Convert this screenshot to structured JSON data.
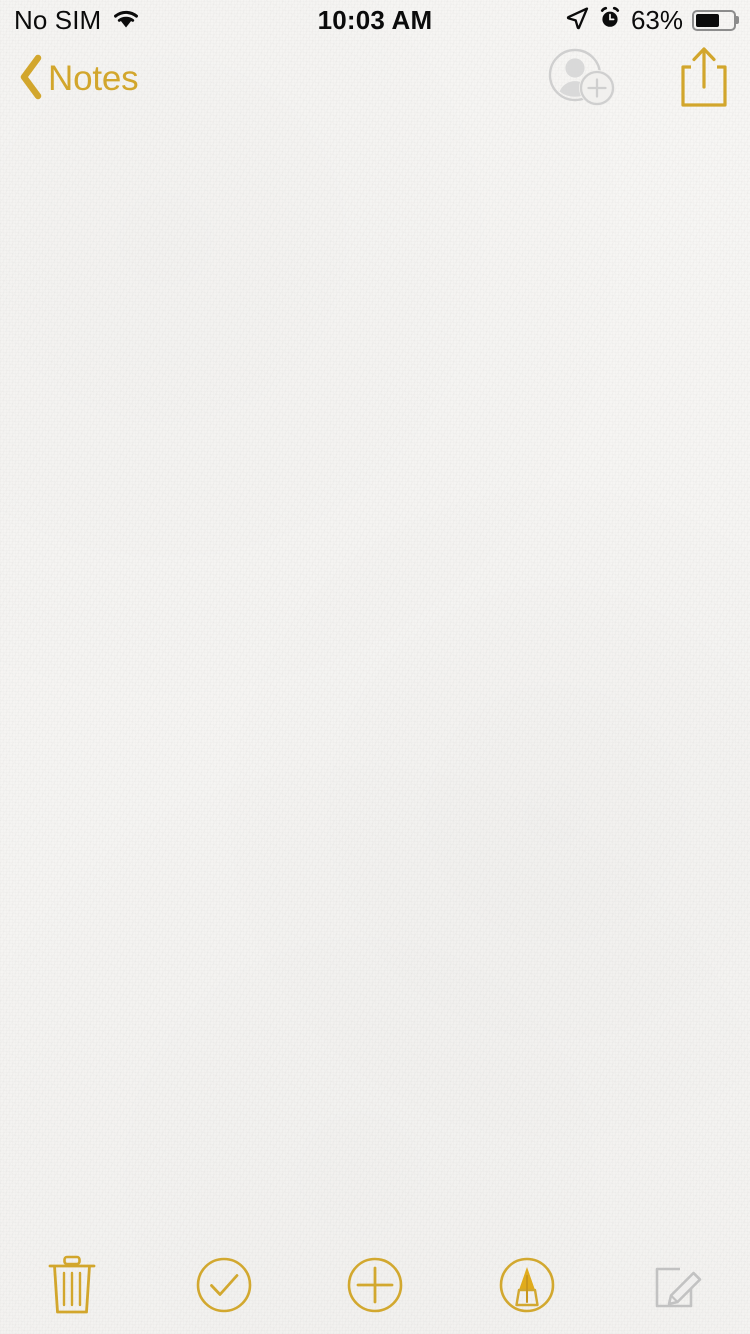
{
  "app": {
    "name": "Notes",
    "accent_color": "#d2a62c",
    "disabled_color": "#c9c9c9",
    "paper_color": "#f6f5f3",
    "text_color": "#0b0b0b"
  },
  "status_bar": {
    "carrier": "No SIM",
    "wifi_icon": "wifi-icon",
    "time": "10:03 AM",
    "location_icon": "location-arrow-icon",
    "alarm_icon": "alarm-clock-icon",
    "battery_percent": "63%",
    "battery_level": 63
  },
  "nav_bar": {
    "back_label": "Notes",
    "back_icon": "chevron-left-icon",
    "actions": [
      {
        "name": "add-people-icon",
        "label": "Add People",
        "enabled": false
      },
      {
        "name": "share-icon",
        "label": "Share",
        "enabled": true
      }
    ]
  },
  "note": {
    "content": "",
    "placeholder": ""
  },
  "toolbar": {
    "items": [
      {
        "name": "delete-icon",
        "label": "Delete",
        "enabled": true
      },
      {
        "name": "checklist-icon",
        "label": "Checklist",
        "enabled": true
      },
      {
        "name": "add-attachment-icon",
        "label": "Add",
        "enabled": true
      },
      {
        "name": "markup-icon",
        "label": "Markup",
        "enabled": true
      },
      {
        "name": "compose-icon",
        "label": "New Note",
        "enabled": false
      }
    ]
  }
}
